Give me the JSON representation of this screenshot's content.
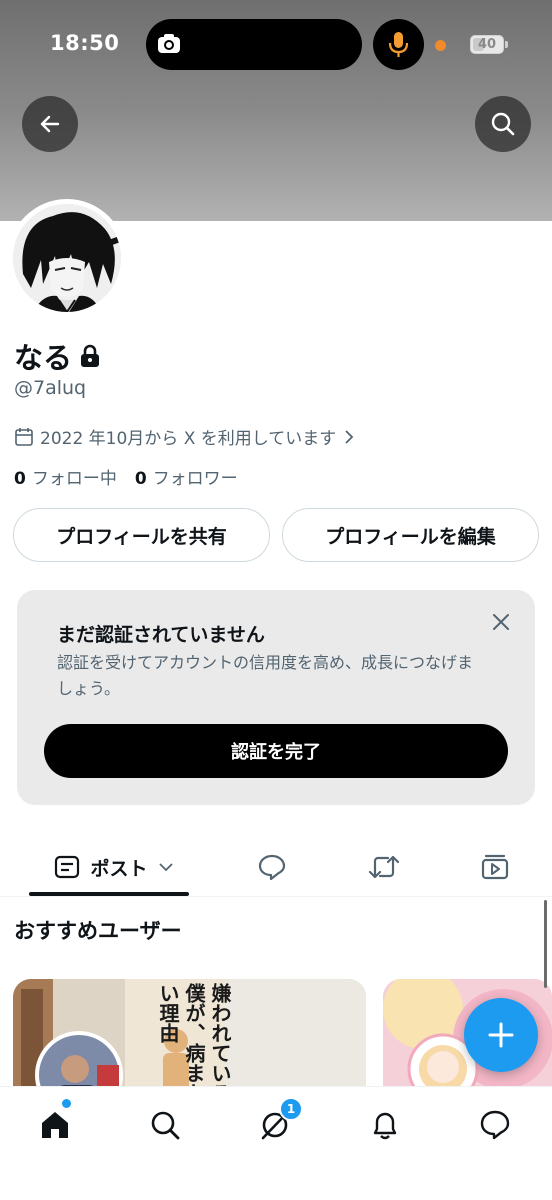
{
  "status_bar": {
    "time": "18:50",
    "battery_level": "40",
    "battery_fraction": 0.4
  },
  "header": {
    "back_icon": "arrow-left-icon",
    "search_icon": "search-icon"
  },
  "profile": {
    "display_name": "なる",
    "handle": "@7aluq",
    "joined": "2022 年10月から X を利用しています",
    "following_count": "0",
    "following_label": "フォロー中",
    "followers_count": "0",
    "followers_label": "フォロワー"
  },
  "actions": {
    "share_profile": "プロフィールを共有",
    "edit_profile": "プロフィールを編集"
  },
  "verification": {
    "title": "まだ認証されていません",
    "body": "認証を受けてアカウントの信用度を高め、成長につなげましょう。",
    "button": "認証を完了"
  },
  "tabs": [
    {
      "label": "ポスト",
      "icon": "posts-icon"
    },
    {
      "label": "",
      "icon": "replies-icon"
    },
    {
      "label": "",
      "icon": "repost-icon"
    },
    {
      "label": "",
      "icon": "video-icon"
    }
  ],
  "suggested": {
    "title": "おすすめユーザー",
    "cards": [
      {
        "cover_text": "嫌われている僕が、病まない理由"
      },
      {
        "cover_text": ""
      }
    ]
  },
  "bottom_nav": {
    "notification_badge": "1"
  },
  "colors": {
    "accent": "#1d9bf0",
    "text_primary": "#0f1419",
    "text_secondary": "#536471",
    "verify_card_bg": "#eaeaea"
  }
}
